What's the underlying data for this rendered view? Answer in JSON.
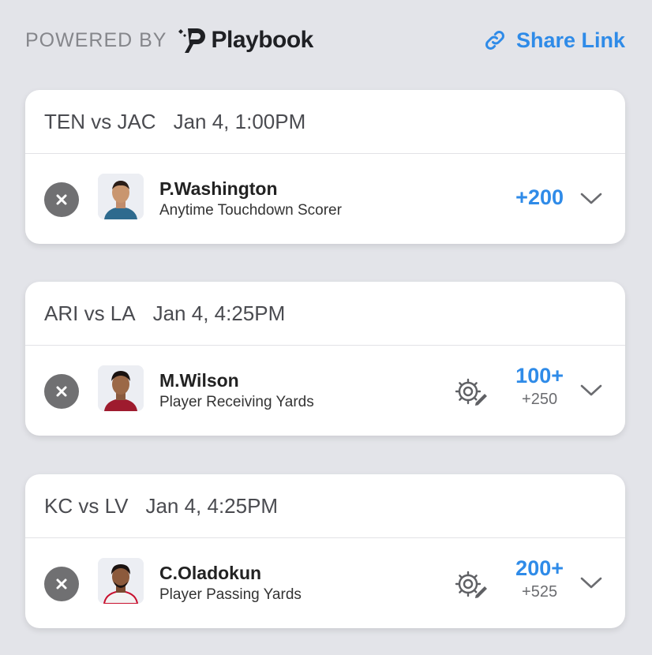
{
  "header": {
    "powered_by": "POWERED BY",
    "brand": "Playbook",
    "share_label": "Share Link",
    "accent": "#2f8be8"
  },
  "picks": [
    {
      "matchup": "TEN vs JAC",
      "time": "Jan 4, 1:00PM",
      "player": "P.Washington",
      "market": "Anytime Touchdown Scorer",
      "odds": "+200",
      "line": null,
      "editable": false
    },
    {
      "matchup": "ARI vs LA",
      "time": "Jan 4, 4:25PM",
      "player": "M.Wilson",
      "market": "Player Receiving Yards",
      "line": "100+",
      "odds": "+250",
      "editable": true
    },
    {
      "matchup": "KC vs LV",
      "time": "Jan 4, 4:25PM",
      "player": "C.Oladokun",
      "market": "Player Passing Yards",
      "line": "200+",
      "odds": "+525",
      "editable": true
    }
  ],
  "icons": {
    "remove": "close-icon",
    "share": "link-icon",
    "edit": "gear-pencil-icon",
    "expand": "chevron-down-icon"
  }
}
